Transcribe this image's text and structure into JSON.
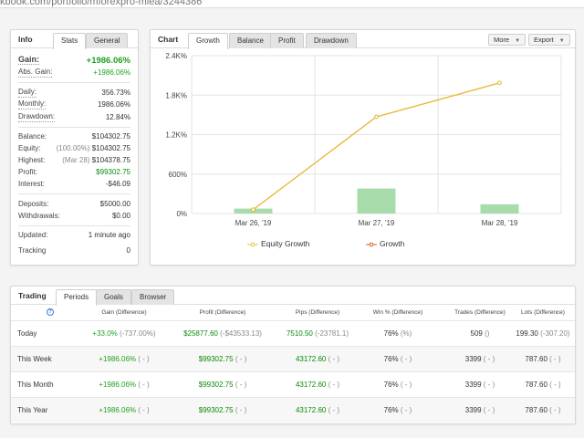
{
  "browser": {
    "url_fragment": "kbook.com/portfolio/mforexpro-mlea/3244386"
  },
  "info": {
    "title": "Info",
    "tabs": [
      "Stats",
      "General"
    ],
    "rows": {
      "gain": {
        "label": "Gain:",
        "value": "+1986.06%"
      },
      "abs_gain": {
        "label": "Abs. Gain:",
        "value": "+1986.06%"
      },
      "daily": {
        "label": "Daily:",
        "value": "356.73%"
      },
      "monthly": {
        "label": "Monthly:",
        "value": "1986.06%"
      },
      "drawdown": {
        "label": "Drawdown:",
        "value": "12.84%"
      },
      "balance": {
        "label": "Balance:",
        "value": "$104302.75"
      },
      "equity": {
        "label": "Equity:",
        "note": "(100.00%)",
        "value": "$104302.75"
      },
      "highest": {
        "label": "Highest:",
        "note": "(Mar 28)",
        "value": "$104378.75"
      },
      "profit": {
        "label": "Profit:",
        "value": "$99302.75"
      },
      "interest": {
        "label": "Interest:",
        "value": "-$46.09"
      },
      "deposits": {
        "label": "Deposits:",
        "value": "$5000.00"
      },
      "withdrawals": {
        "label": "Withdrawals:",
        "value": "$0.00"
      },
      "updated": {
        "label": "Updated:",
        "value": "1 minute ago"
      },
      "tracking": {
        "label": "Tracking",
        "value": "0"
      }
    }
  },
  "chart_panel": {
    "title": "Chart",
    "tabs": [
      "Growth",
      "Balance",
      "Profit",
      "Drawdown"
    ],
    "more_label": "More",
    "export_label": "Export",
    "legend": [
      "Equity Growth",
      "Growth"
    ]
  },
  "chart_data": {
    "type": "line",
    "categories": [
      "Mar 26, '19",
      "Mar 27, '19",
      "Mar 28, '19"
    ],
    "y_ticks": [
      "0%",
      "600%",
      "1.2K%",
      "1.8K%",
      "2.4K%"
    ],
    "ylim": [
      0,
      2400
    ],
    "series": [
      {
        "name": "Growth",
        "type": "line",
        "values": [
          60,
          1470,
          1986.06
        ],
        "color": "#e05a10"
      },
      {
        "name": "Equity Growth",
        "type": "line",
        "values": [
          60,
          1470,
          1986.06
        ],
        "color": "#e8c33c"
      },
      {
        "type": "bar",
        "values": [
          75,
          380,
          140
        ],
        "color": "#a8dcaa"
      }
    ],
    "grid": true,
    "legend_position": "bottom"
  },
  "trading": {
    "title": "Trading",
    "tabs": [
      "Periods",
      "Goals",
      "Browser"
    ],
    "headers": [
      "Gain (Difference)",
      "Profit (Difference)",
      "Pips (Difference)",
      "Win % (Difference)",
      "Trades (Difference)",
      "Lots (Difference)"
    ],
    "rows": [
      {
        "period": "Today",
        "gain": "+33.0%",
        "gain_diff": "(-737.00%)",
        "profit": "$25877.60",
        "profit_diff": "(-$43533.13)",
        "pips": "7510.50",
        "pips_diff": "(-23781.1)",
        "win": "76%",
        "win_diff": "(%)",
        "trades": "509",
        "trades_diff": "()",
        "lots": "199.30",
        "lots_diff": "(-307.20)"
      },
      {
        "period": "This Week",
        "gain": "+1986.06%",
        "gain_diff": "( - )",
        "profit": "$99302.75",
        "profit_diff": "( - )",
        "pips": "43172.60",
        "pips_diff": "( - )",
        "win": "76%",
        "win_diff": "( - )",
        "trades": "3399",
        "trades_diff": "( - )",
        "lots": "787.60",
        "lots_diff": "( - )"
      },
      {
        "period": "This Month",
        "gain": "+1986.06%",
        "gain_diff": "( - )",
        "profit": "$99302.75",
        "profit_diff": "( - )",
        "pips": "43172.60",
        "pips_diff": "( - )",
        "win": "76%",
        "win_diff": "( - )",
        "trades": "3399",
        "trades_diff": "( - )",
        "lots": "787.60",
        "lots_diff": "( - )"
      },
      {
        "period": "This Year",
        "gain": "+1986.06%",
        "gain_diff": "( - )",
        "profit": "$99302.75",
        "profit_diff": "( - )",
        "pips": "43172.60",
        "pips_diff": "( - )",
        "win": "76%",
        "win_diff": "( - )",
        "trades": "3399",
        "trades_diff": "( - )",
        "lots": "787.60",
        "lots_diff": "( - )"
      }
    ]
  },
  "colors": {
    "positive": "#21a121",
    "growth_line": "#e05a10",
    "equity_line": "#e8c33c",
    "bar": "#a8dcaa",
    "info_icon": "#3a7bd5"
  }
}
